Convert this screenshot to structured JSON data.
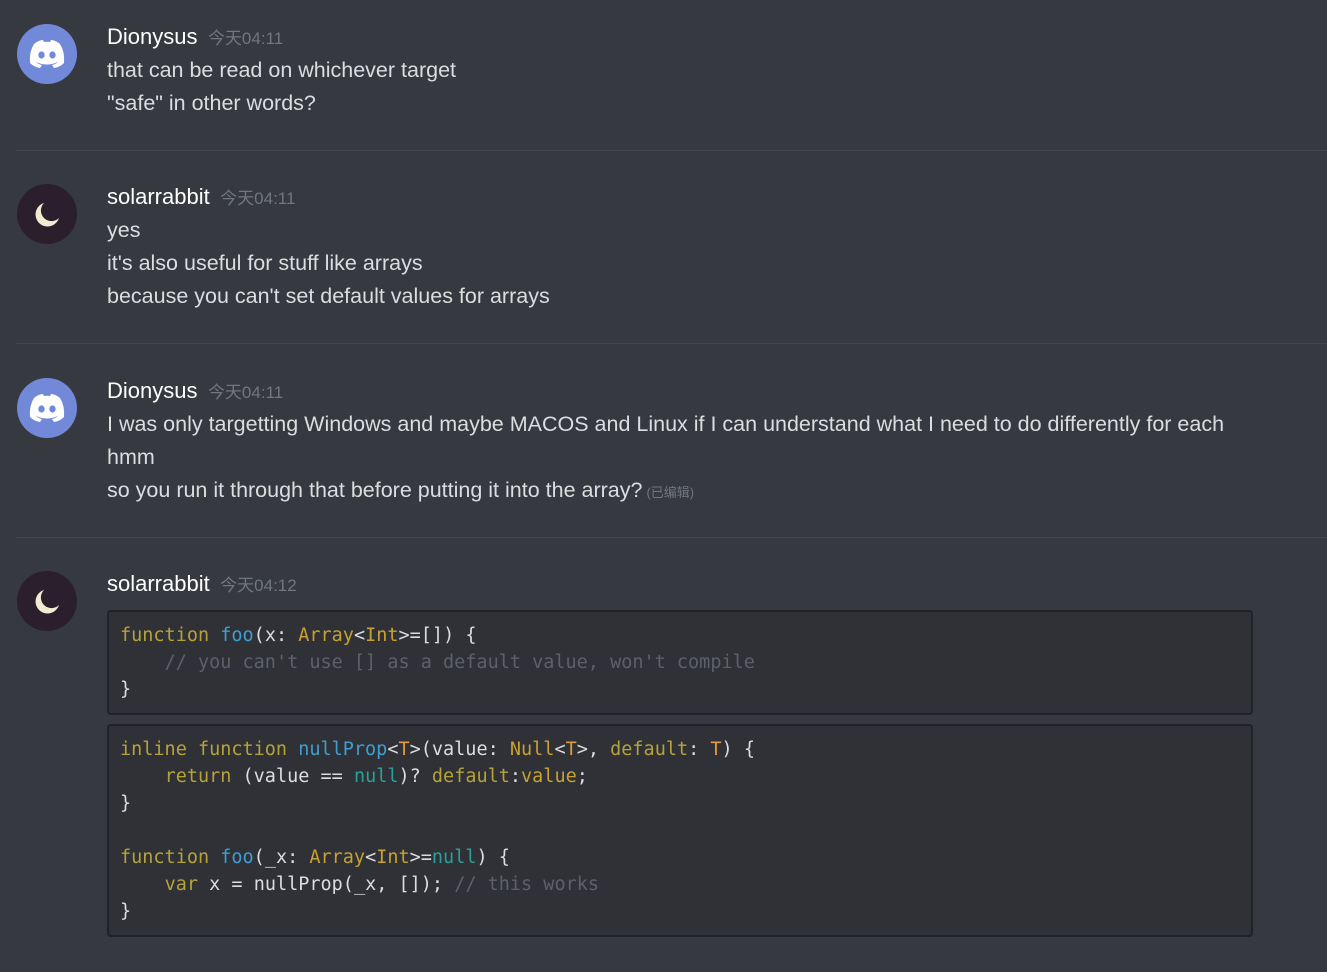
{
  "messages": [
    {
      "author": "Dionysus",
      "avatar_icon": "discord-logo-icon",
      "timestamp": "今天04:11",
      "lines": [
        "that can be read on whichever target",
        "\"safe\" in other words?"
      ]
    },
    {
      "author": "solarrabbit",
      "avatar_icon": "crescent-moon-icon",
      "timestamp": "今天04:11",
      "lines": [
        "yes",
        "it's also useful for stuff like arrays",
        "because you can't set default values for arrays"
      ]
    },
    {
      "author": "Dionysus",
      "avatar_icon": "discord-logo-icon",
      "timestamp": "今天04:11",
      "lines": [
        "I was only targetting Windows and maybe MACOS and Linux if I can understand what I need to do differently for each",
        "hmm",
        "so you run it through that before putting it into the array?"
      ],
      "edited_label": "(已编辑)"
    },
    {
      "author": "solarrabbit",
      "avatar_icon": "crescent-moon-icon",
      "timestamp": "今天04:12",
      "code_blocks": [
        [
          "function foo(x: Array<Int>=[]) {",
          "    // you can't use [] as a default value, won't compile",
          "}"
        ],
        [
          "inline function nullProp<T>(value: Null<T>, default: T) {",
          "    return (value == null)? default:value;",
          "}",
          "",
          "function foo(_x: Array<Int>=null) {",
          "    var x = nullProp(_x, []); // this works",
          "}"
        ]
      ]
    }
  ],
  "colors": {
    "background": "#36393f",
    "code_background": "#2f3136",
    "username": "#ffffff",
    "timestamp": "#72767d",
    "text": "#dcddde",
    "discord_avatar": "#7289da",
    "keyword": "#b5a33a",
    "function_name": "#3d9fd3",
    "type": "#c7a230",
    "null_literal": "#2aa198",
    "comment": "#5d6167"
  }
}
